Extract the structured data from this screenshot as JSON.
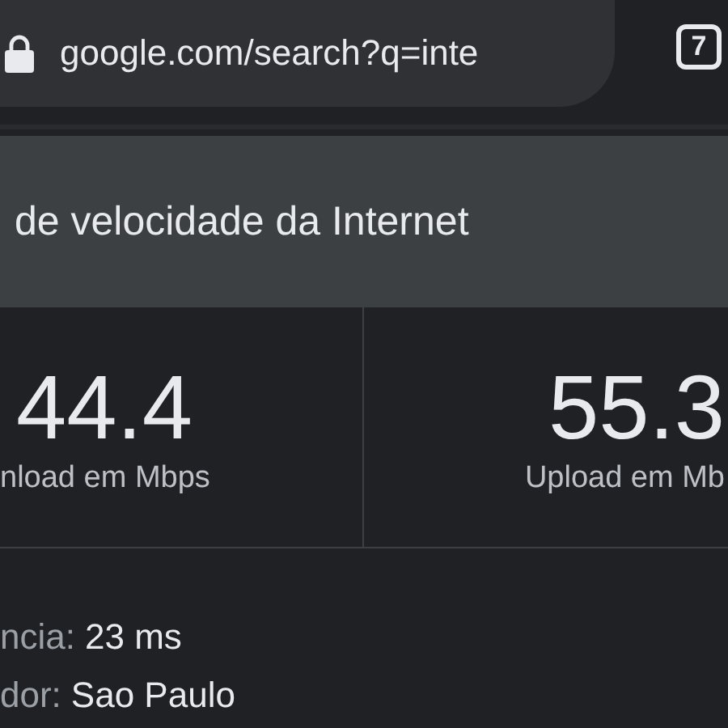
{
  "address_bar": {
    "url": "google.com/search?q=inte",
    "secure": true,
    "tab_count": "7"
  },
  "header": {
    "title": "de velocidade da Internet"
  },
  "results": [
    {
      "value": "44.4",
      "label": "nload em Mbps"
    },
    {
      "value": "55.3",
      "label": "Upload em Mb"
    }
  ],
  "details": [
    {
      "label": "ncia:",
      "value": "23 ms"
    },
    {
      "label": "dor:",
      "value": "Sao Paulo"
    }
  ]
}
